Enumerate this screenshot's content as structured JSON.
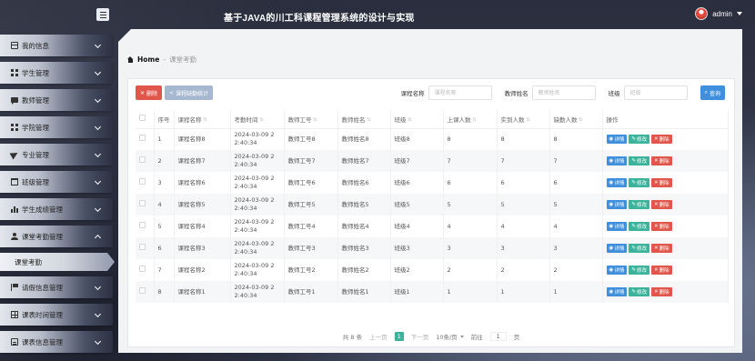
{
  "app": {
    "title": "基于JAVA的川工科课程管理系统的设计与实现",
    "user": "admin"
  },
  "sidebar": {
    "items": [
      {
        "label": "我的信息",
        "icon": "window-icon",
        "open": false
      },
      {
        "label": "学生管理",
        "icon": "grid-icon",
        "open": false
      },
      {
        "label": "教师管理",
        "icon": "chat-icon",
        "open": false
      },
      {
        "label": "学院管理",
        "icon": "grid-icon",
        "open": false
      },
      {
        "label": "专业管理",
        "icon": "send-icon",
        "open": false
      },
      {
        "label": "班级管理",
        "icon": "calendar-icon",
        "open": false
      },
      {
        "label": "学生成绩管理",
        "icon": "bar-chart-icon",
        "open": false
      },
      {
        "label": "课堂考勤管理",
        "icon": "user-icon",
        "open": true
      },
      {
        "label": "请假信息管理",
        "icon": "flag-icon",
        "open": false
      },
      {
        "label": "课表时间管理",
        "icon": "table-icon",
        "open": false
      },
      {
        "label": "课表信息管理",
        "icon": "clipboard-icon",
        "open": false
      }
    ],
    "active_sub": "课堂考勤"
  },
  "breadcrumb": {
    "home": "Home",
    "separator": "-",
    "current": "课堂考勤"
  },
  "toolbar": {
    "delete": "删除",
    "stats": "课程缺勤统计"
  },
  "filters": {
    "course_label": "课程名称",
    "course_placeholder": "课程名称",
    "teacher_label": "教师姓名",
    "teacher_placeholder": "教师姓名",
    "class_label": "班级",
    "class_placeholder": "班级",
    "search": "查询"
  },
  "table": {
    "headers": [
      "序号",
      "课程名称",
      "考勤时间",
      "教师工号",
      "教师姓名",
      "班级",
      "上课人数",
      "实到人数",
      "缺勤人数",
      "操作"
    ],
    "rows": [
      {
        "no": "1",
        "course": "课程名称8",
        "time": "2024-03-09 22:40:34",
        "tno": "教师工号8",
        "tname": "教师姓名8",
        "cls": "班级8",
        "total": "8",
        "present": "8",
        "absent": "8"
      },
      {
        "no": "2",
        "course": "课程名称7",
        "time": "2024-03-09 22:40:34",
        "tno": "教师工号7",
        "tname": "教师姓名7",
        "cls": "班级7",
        "total": "7",
        "present": "7",
        "absent": "7"
      },
      {
        "no": "3",
        "course": "课程名称6",
        "time": "2024-03-09 22:40:34",
        "tno": "教师工号6",
        "tname": "教师姓名6",
        "cls": "班级6",
        "total": "6",
        "present": "6",
        "absent": "6"
      },
      {
        "no": "4",
        "course": "课程名称5",
        "time": "2024-03-09 22:40:34",
        "tno": "教师工号5",
        "tname": "教师姓名5",
        "cls": "班级5",
        "total": "5",
        "present": "5",
        "absent": "5"
      },
      {
        "no": "5",
        "course": "课程名称4",
        "time": "2024-03-09 22:40:34",
        "tno": "教师工号4",
        "tname": "教师姓名4",
        "cls": "班级4",
        "total": "4",
        "present": "4",
        "absent": "4"
      },
      {
        "no": "6",
        "course": "课程名称3",
        "time": "2024-03-09 22:40:34",
        "tno": "教师工号3",
        "tname": "教师姓名3",
        "cls": "班级3",
        "total": "3",
        "present": "3",
        "absent": "3"
      },
      {
        "no": "7",
        "course": "课程名称2",
        "time": "2024-03-09 22:40:34",
        "tno": "教师工号2",
        "tname": "教师姓名2",
        "cls": "班级2",
        "total": "2",
        "present": "2",
        "absent": "2"
      },
      {
        "no": "8",
        "course": "课程名称1",
        "time": "2024-03-09 22:40:34",
        "tno": "教师工号1",
        "tname": "教师姓名1",
        "cls": "班级1",
        "total": "1",
        "present": "1",
        "absent": "1"
      }
    ],
    "ops": {
      "detail": "详情",
      "edit": "修改",
      "delete": "删除"
    }
  },
  "pager": {
    "total": "共 8 条",
    "prev": "上一页",
    "current": "1",
    "next": "下一页",
    "size": "10条/页",
    "goto": "前往",
    "goto_value": "1",
    "page_unit": "页"
  },
  "colors": {
    "primary": "#3f8fdc",
    "danger": "#e0564a",
    "success": "#3cb49b"
  }
}
